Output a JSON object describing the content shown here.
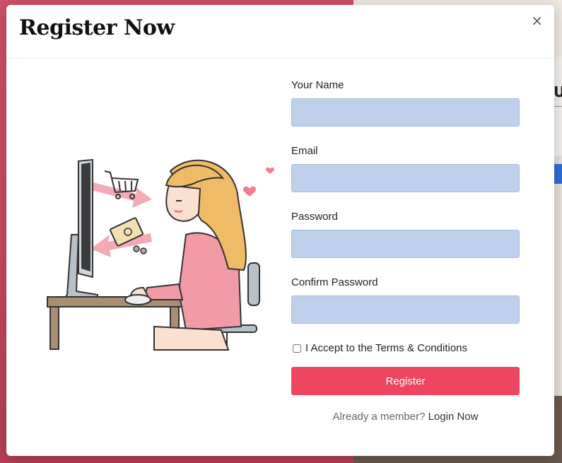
{
  "modal": {
    "title": "Register Now",
    "close_label": "×"
  },
  "form": {
    "name_label": "Your Name",
    "email_label": "Email",
    "password_label": "Password",
    "confirm_password_label": "Confirm Password",
    "terms_label": "I Accept to the Terms & Conditions",
    "terms_checked": false,
    "register_button": "Register",
    "login_prompt": "Already a member?",
    "login_link": "Login Now"
  },
  "colors": {
    "accent": "#ee4561",
    "input_bg": "#bed0ec",
    "backdrop": "#c64960"
  },
  "background_page": {
    "edge_letter": "U"
  }
}
